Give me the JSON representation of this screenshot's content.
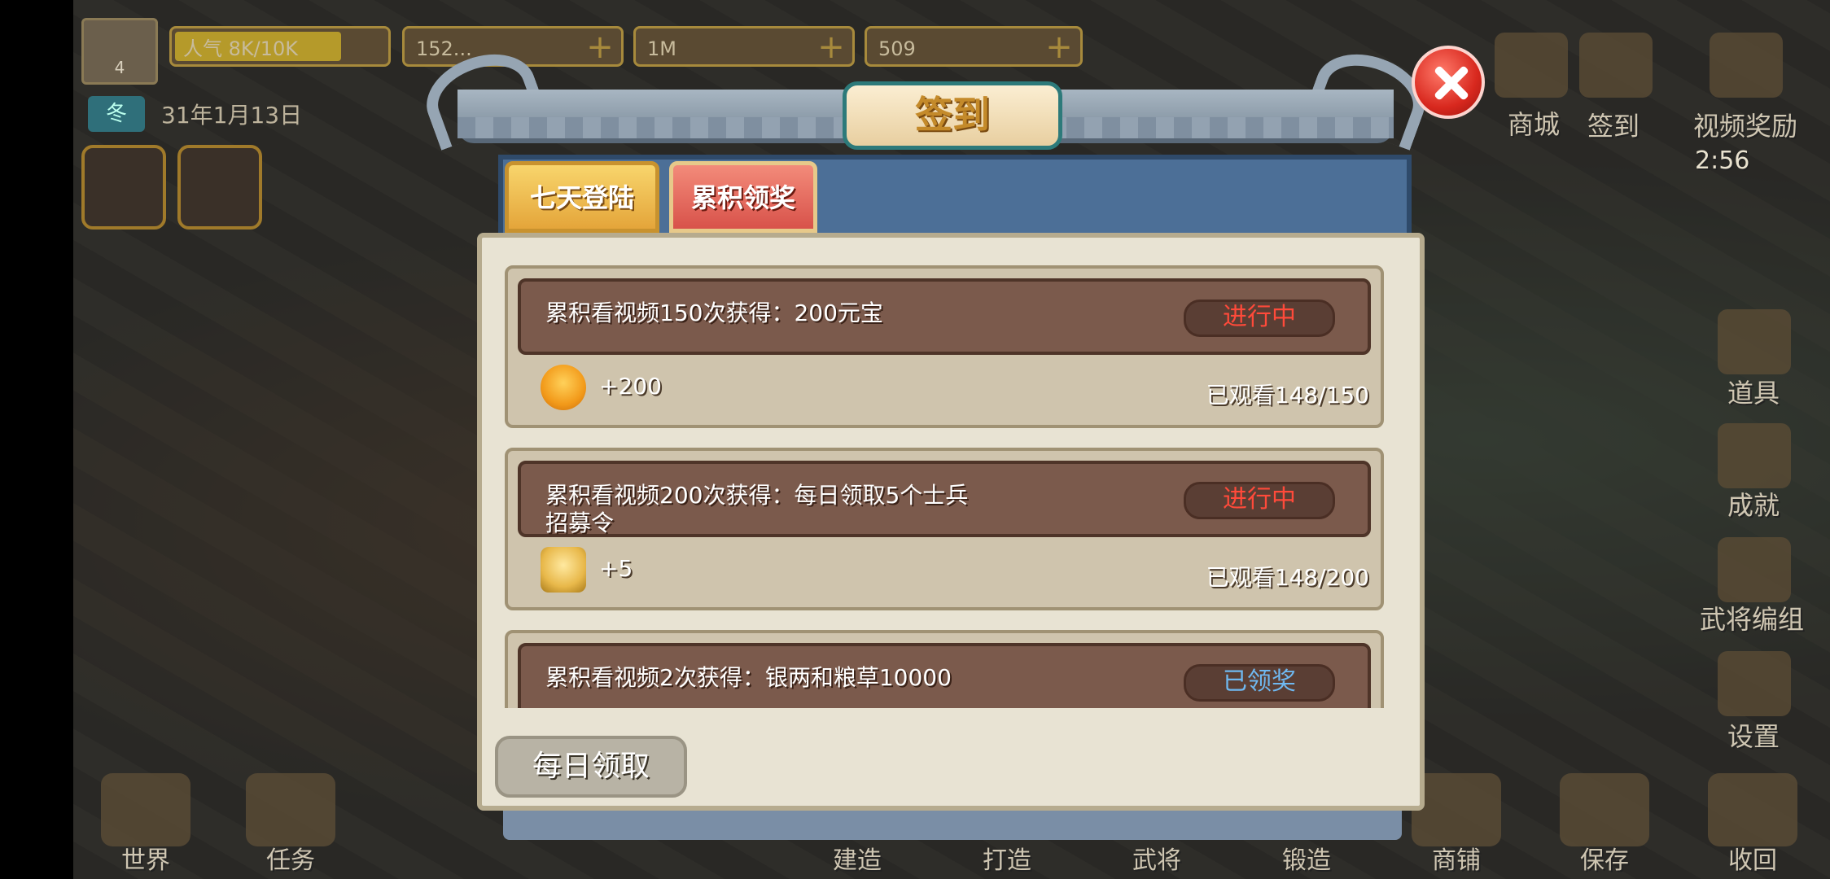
{
  "hud": {
    "level": "4",
    "popularity": {
      "label": "人气 8K/10K",
      "fraction": 0.8
    },
    "resource1": "152...",
    "resource2": "1M",
    "resource3": "509",
    "season": "冬",
    "date": "31年1月13日"
  },
  "top_right": {
    "shop_label": "商城",
    "signin_label": "签到",
    "video_reward_label": "视频奖励",
    "video_timer": "2:56"
  },
  "right_menu": [
    "道具",
    "成就",
    "武将编组",
    "设置"
  ],
  "bottom_bar": [
    "世界",
    "任务",
    "建造",
    "打造",
    "武将",
    "锻造",
    "商铺",
    "保存",
    "收回"
  ],
  "modal": {
    "title": "签到",
    "tabs": [
      {
        "label": "七天登陆",
        "state": "inactive"
      },
      {
        "label": "累积领奖",
        "state": "active"
      }
    ],
    "items": [
      {
        "title": "累积看视频150次获得：200元宝",
        "status": "进行中",
        "reward_icon": "gold-ingot-icon",
        "reward_amount": "+200",
        "progress": "已观看148/150"
      },
      {
        "title": "累积看视频200次获得：每日领取5个士兵招募令",
        "status": "进行中",
        "reward_icon": "recruit-token-icon",
        "reward_amount": "+5",
        "progress": "已观看148/200"
      },
      {
        "title": "累积看视频2次获得：银两和粮草10000",
        "status": "已领奖",
        "reward_icon": "",
        "reward_amount": "",
        "progress": ""
      }
    ],
    "daily_button": "每日领取"
  },
  "colors": {
    "status_in_progress": "#ff4a3a",
    "status_claimed": "#6fb8f0",
    "active_tab": "#d8524a",
    "inactive_tab": "#e4a53a"
  }
}
